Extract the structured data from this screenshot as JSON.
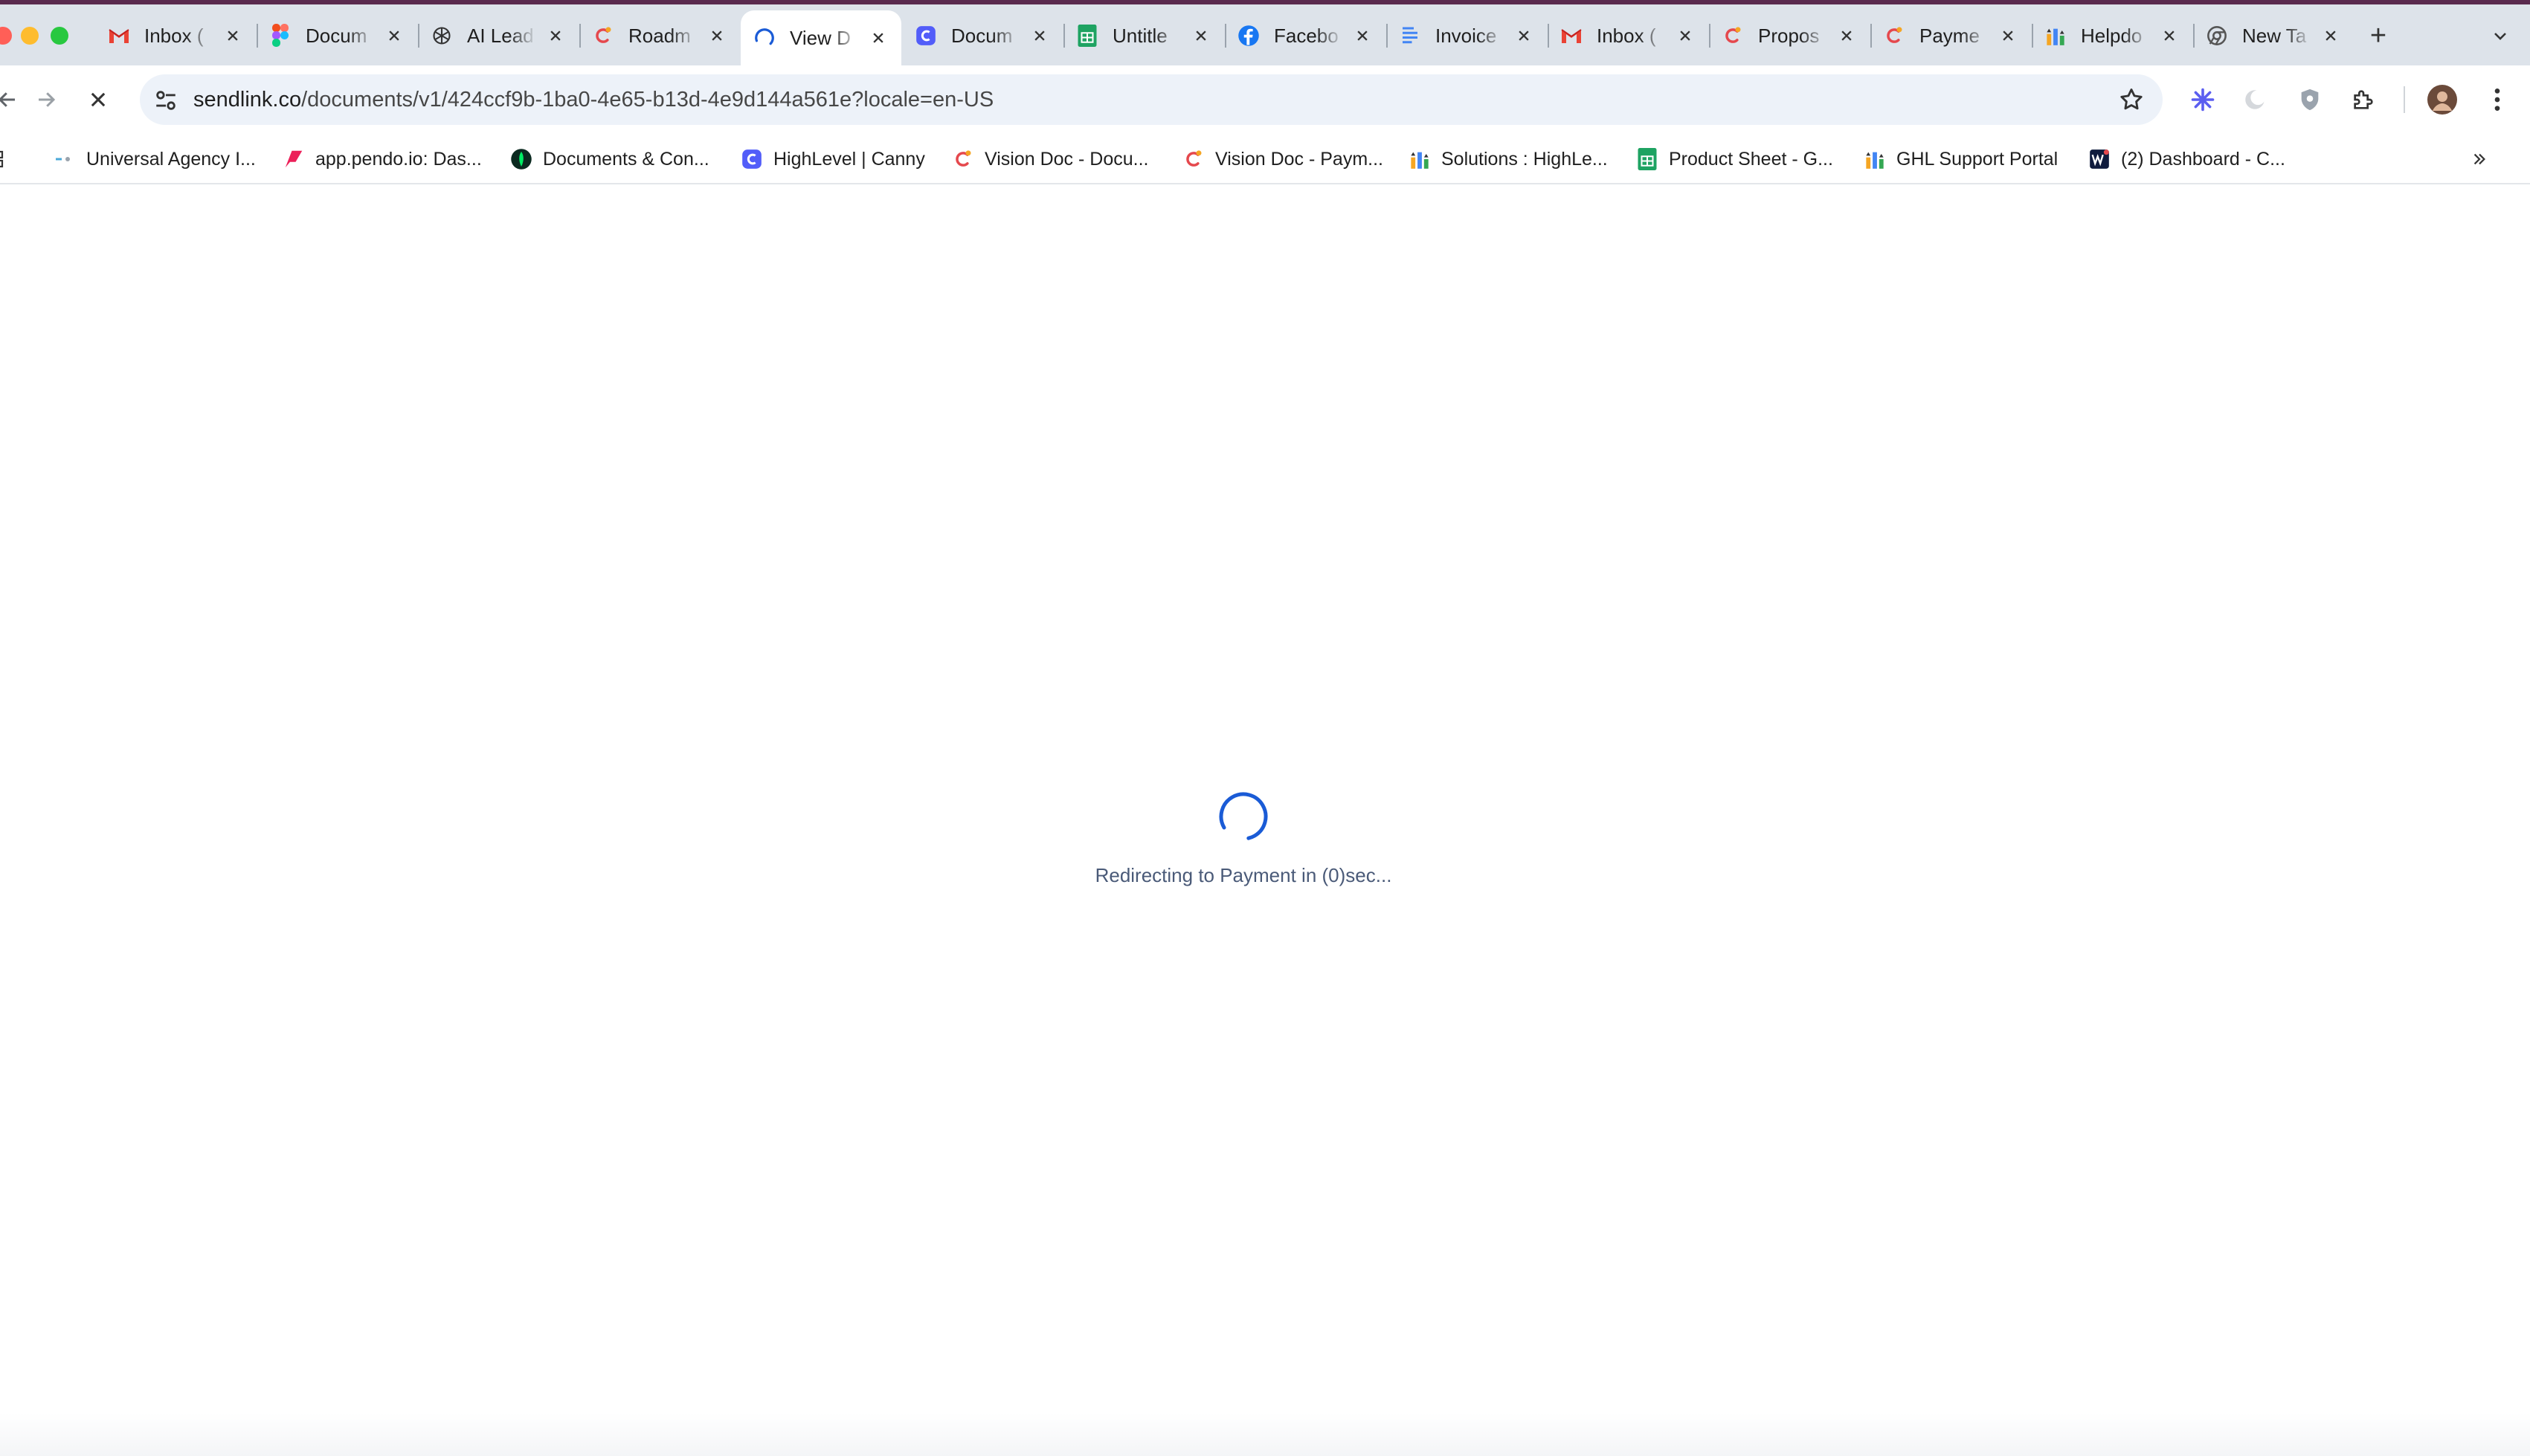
{
  "browser": {
    "tabs": [
      {
        "title": "Inbox (",
        "icon": "gmail-icon"
      },
      {
        "title": "Docum",
        "icon": "figma-icon"
      },
      {
        "title": "AI Lead",
        "icon": "openai-icon"
      },
      {
        "title": "Roadm",
        "icon": "highlevel-icon"
      },
      {
        "title": "View D",
        "icon": "loading-spinner-icon",
        "active": true
      },
      {
        "title": "Docum",
        "icon": "canny-icon"
      },
      {
        "title": "Untitle",
        "icon": "google-sheets-icon"
      },
      {
        "title": "Facebo",
        "icon": "facebook-icon"
      },
      {
        "title": "Invoice",
        "icon": "google-docs-icon"
      },
      {
        "title": "Inbox (",
        "icon": "gmail-icon"
      },
      {
        "title": "Propos",
        "icon": "highlevel-icon"
      },
      {
        "title": "Payme",
        "icon": "highlevel-icon"
      },
      {
        "title": "Helpdo",
        "icon": "ghl-chart-icon"
      },
      {
        "title": "New Ta",
        "icon": "chrome-icon"
      }
    ],
    "new_tab_symbol": "+",
    "address_bar": {
      "domain": "sendlink.co",
      "path": "/documents/v1/424ccf9b-1ba0-4e65-b13d-4e9d144a561e?locale=en-US"
    },
    "bookmarks": [
      {
        "label": "Universal Agency I...",
        "icon": "agency-icon"
      },
      {
        "label": "app.pendo.io: Das...",
        "icon": "pendo-icon"
      },
      {
        "label": "Documents & Con...",
        "icon": "mongodb-icon"
      },
      {
        "label": "HighLevel | Canny",
        "icon": "canny-icon"
      },
      {
        "label": "Vision Doc - Docu...",
        "icon": "highlevel-icon"
      },
      {
        "label": "Vision Doc - Paym...",
        "icon": "highlevel-icon"
      },
      {
        "label": "Solutions : HighLe...",
        "icon": "ghl-chart-icon"
      },
      {
        "label": "Product Sheet - G...",
        "icon": "google-sheets-icon"
      },
      {
        "label": "GHL Support Portal",
        "icon": "ghl-chart-icon"
      },
      {
        "label": "(2) Dashboard - C...",
        "icon": "dashboard-icon"
      }
    ]
  },
  "page": {
    "status_text": "Redirecting to Payment in (0)sec..."
  },
  "colors": {
    "spinner": "#1a5bd6",
    "status_text": "#4a5a78",
    "tabstrip_bg": "#dde3ea"
  }
}
